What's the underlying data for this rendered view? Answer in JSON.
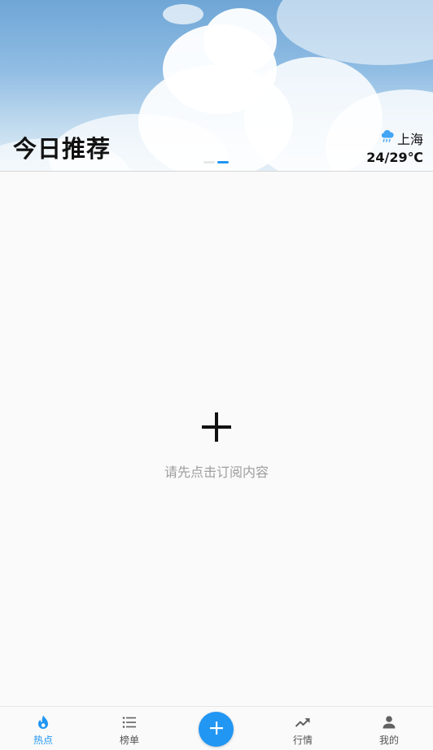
{
  "header": {
    "title": "今日推荐",
    "weather": {
      "icon": "rain-cloud-icon",
      "city": "上海",
      "temperature": "24/29℃"
    },
    "carousel": {
      "slides": 2,
      "active_index": 1
    }
  },
  "empty_state": {
    "icon": "plus-icon",
    "message": "请先点击订阅内容"
  },
  "bottom_nav": {
    "items": [
      {
        "label": "热点",
        "icon": "flame-icon",
        "active": true
      },
      {
        "label": "榜单",
        "icon": "list-icon",
        "active": false
      },
      {
        "label": "",
        "icon": "plus-icon",
        "active": false
      },
      {
        "label": "行情",
        "icon": "trending-up-icon",
        "active": false
      },
      {
        "label": "我的",
        "icon": "person-icon",
        "active": false
      }
    ]
  },
  "colors": {
    "accent": "#2196f3",
    "background": "#fafafa",
    "muted_text": "#9e9e9e",
    "inactive_icon": "#616161",
    "indicator_inactive": "#e8e8e8"
  }
}
